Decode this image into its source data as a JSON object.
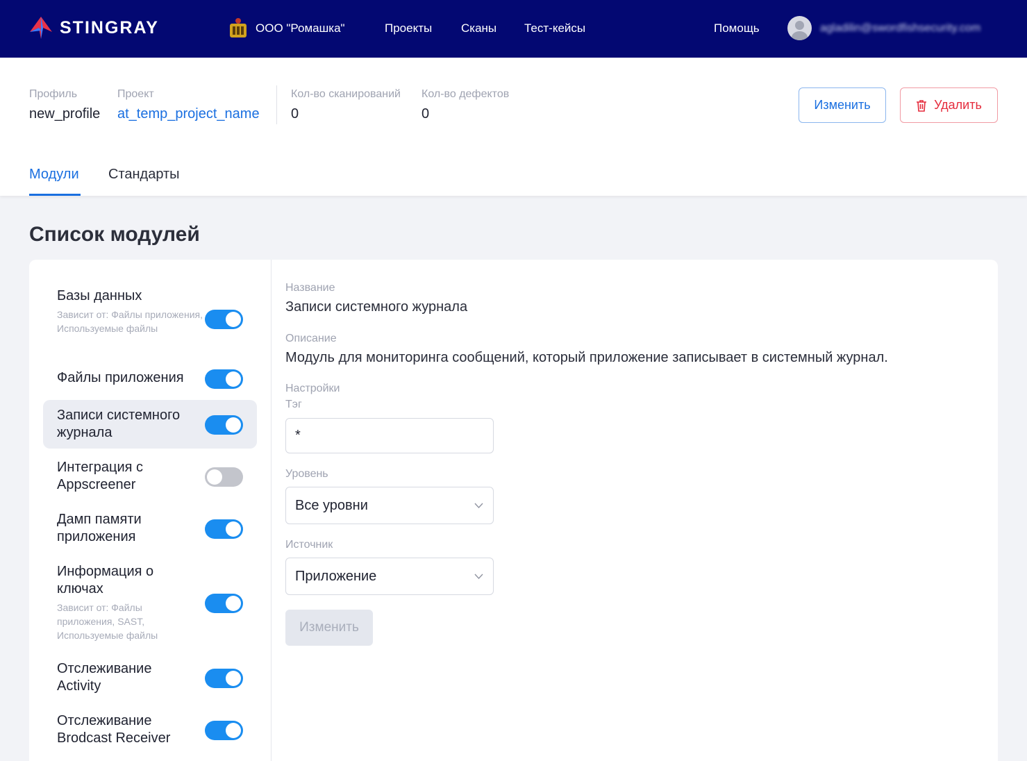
{
  "app": {
    "name": "STINGRAY"
  },
  "topnav": {
    "org": "ООО \"Ромашка\"",
    "links": [
      "Проекты",
      "Сканы",
      "Тест-кейсы"
    ],
    "help": "Помощь",
    "user_email": "agladilin@swordfishsecurity.com"
  },
  "header": {
    "profile_label": "Профиль",
    "profile_value": "new_profile",
    "project_label": "Проект",
    "project_value": "at_temp_project_name",
    "scans_label": "Кол-во сканирований",
    "scans_value": "0",
    "defects_label": "Кол-во дефектов",
    "defects_value": "0",
    "edit_label": "Изменить",
    "delete_label": "Удалить",
    "tabs": [
      {
        "label": "Модули",
        "active": true
      },
      {
        "label": "Стандарты",
        "active": false
      }
    ]
  },
  "page_title": "Список модулей",
  "modules": [
    {
      "name": "Базы данных",
      "depends": "Зависит от:  Файлы приложения, Используемые файлы",
      "enabled": true,
      "selected": false
    },
    {
      "name": "Файлы приложения",
      "depends": "",
      "enabled": true,
      "selected": false
    },
    {
      "name": "Записи системного журнала",
      "depends": "",
      "enabled": true,
      "selected": true
    },
    {
      "name": "Интеграция с Appscreener",
      "depends": "",
      "enabled": false,
      "selected": false
    },
    {
      "name": "Дамп памяти приложения",
      "depends": "",
      "enabled": true,
      "selected": false
    },
    {
      "name": "Информация о ключах",
      "depends": "Зависит от:  Файлы приложения, SAST, Используемые файлы",
      "enabled": true,
      "selected": false
    },
    {
      "name": "Отслеживание Activity",
      "depends": "",
      "enabled": true,
      "selected": false
    },
    {
      "name": "Отслеживание Brodcast Receiver",
      "depends": "",
      "enabled": true,
      "selected": false
    }
  ],
  "detail": {
    "name_label": "Название",
    "name_value": "Записи системного журнала",
    "desc_label": "Описание",
    "desc_value": "Модуль для мониторинга сообщений, который приложение записывает в системный журнал.",
    "settings_label": "Настройки",
    "tag_label": "Тэг",
    "tag_value": "*",
    "level_label": "Уровень",
    "level_value": "Все уровни",
    "source_label": "Источник",
    "source_value": "Приложение",
    "save_label": "Изменить"
  },
  "colors": {
    "nav_bg": "#030872",
    "accent": "#1a6fe0",
    "danger": "#e52b3c",
    "toggle_on": "#1a8df0"
  }
}
